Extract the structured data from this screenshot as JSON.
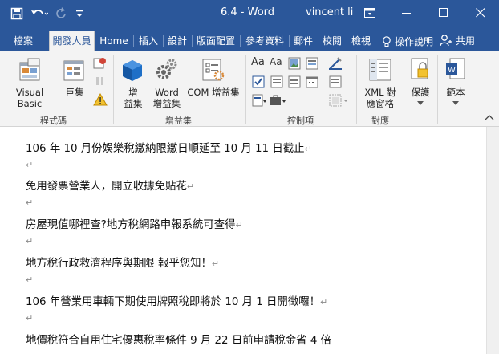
{
  "window": {
    "title": "6.4  -  Word",
    "user": "vincent li"
  },
  "tabs": [
    {
      "label": "檔案"
    },
    {
      "label": "開發人員"
    },
    {
      "label": "Home"
    },
    {
      "label": "插入"
    },
    {
      "label": "設計"
    },
    {
      "label": "版面配置"
    },
    {
      "label": "參考資料"
    },
    {
      "label": "郵件"
    },
    {
      "label": "校閱"
    },
    {
      "label": "檢視"
    },
    {
      "label": "操作說明"
    }
  ],
  "share_label": "共用",
  "ribbon": {
    "code": {
      "visual_basic": "Visual Basic",
      "macros": "巨集",
      "group": "程式碼"
    },
    "addins": {
      "addins_line1": "增",
      "addins_line2": "益集",
      "word_addins_line1": "Word",
      "word_addins_line2": "增益集",
      "com_addins": "COM 增益集",
      "group": "增益集"
    },
    "controls": {
      "group": "控制項"
    },
    "mapping": {
      "xml_line1": "XML 對",
      "xml_line2": "應窗格",
      "group": "對應"
    },
    "protect": {
      "label": "保護"
    },
    "templates": {
      "label": "範本"
    }
  },
  "document": {
    "paragraphs": [
      "106 年 10 月份娛樂稅繳納限繳日順延至 10 月 11 日截止",
      "",
      "免用發票營業人，開立收據免貼花",
      "",
      "房屋現值哪裡查?地方稅網路申報系統可查得",
      "",
      "地方稅行政救濟程序與期限  報乎您知！",
      "",
      "106 年營業用車輛下期使用牌照稅即將於 10 月 1 日開徵囉！",
      "",
      "地價稅符合自用住宅優惠稅率條件  9 月 22 日前申請稅金省 4 倍"
    ],
    "para_mark": "↵"
  },
  "colors": {
    "accent": "#2b579a",
    "ribbon_bg": "#f3f3f3"
  }
}
